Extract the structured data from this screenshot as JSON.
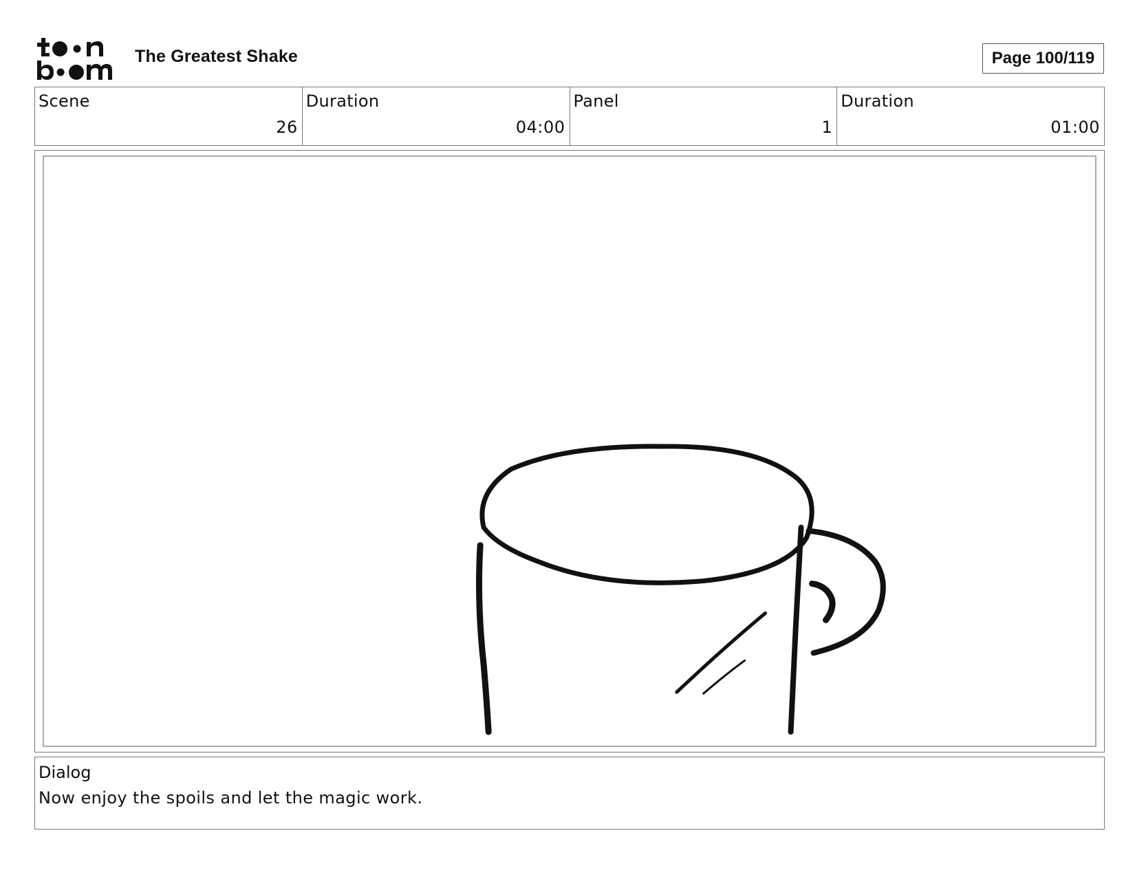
{
  "header": {
    "logo_text": "toon boom",
    "project_title": "The Greatest Shake",
    "page_label": "Page 100/119"
  },
  "info": [
    {
      "label": "Scene",
      "value": "26"
    },
    {
      "label": "Duration",
      "value": "04:00"
    },
    {
      "label": "Panel",
      "value": "1"
    },
    {
      "label": "Duration",
      "value": "01:00"
    }
  ],
  "panel": {
    "drawing": "mug-sketch"
  },
  "dialog": {
    "label": "Dialog",
    "text": "Now enjoy the spoils and let the magic work."
  }
}
